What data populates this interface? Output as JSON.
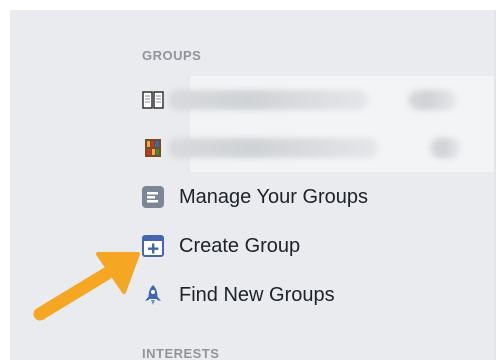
{
  "sections": {
    "groups_title": "GROUPS",
    "interests_title": "INTERESTS"
  },
  "items": [
    {
      "label": "Manage Your Groups",
      "icon": "manage-groups-icon"
    },
    {
      "label": "Create Group",
      "icon": "create-group-icon"
    },
    {
      "label": "Find New Groups",
      "icon": "rocket-icon"
    }
  ],
  "colors": {
    "panel_bg": "#e9ebee",
    "section_text": "#90949c",
    "item_text": "#1d2129",
    "icon_grey": "#7c8796",
    "icon_blue": "#4267b2",
    "arrow": "#f5a623"
  }
}
